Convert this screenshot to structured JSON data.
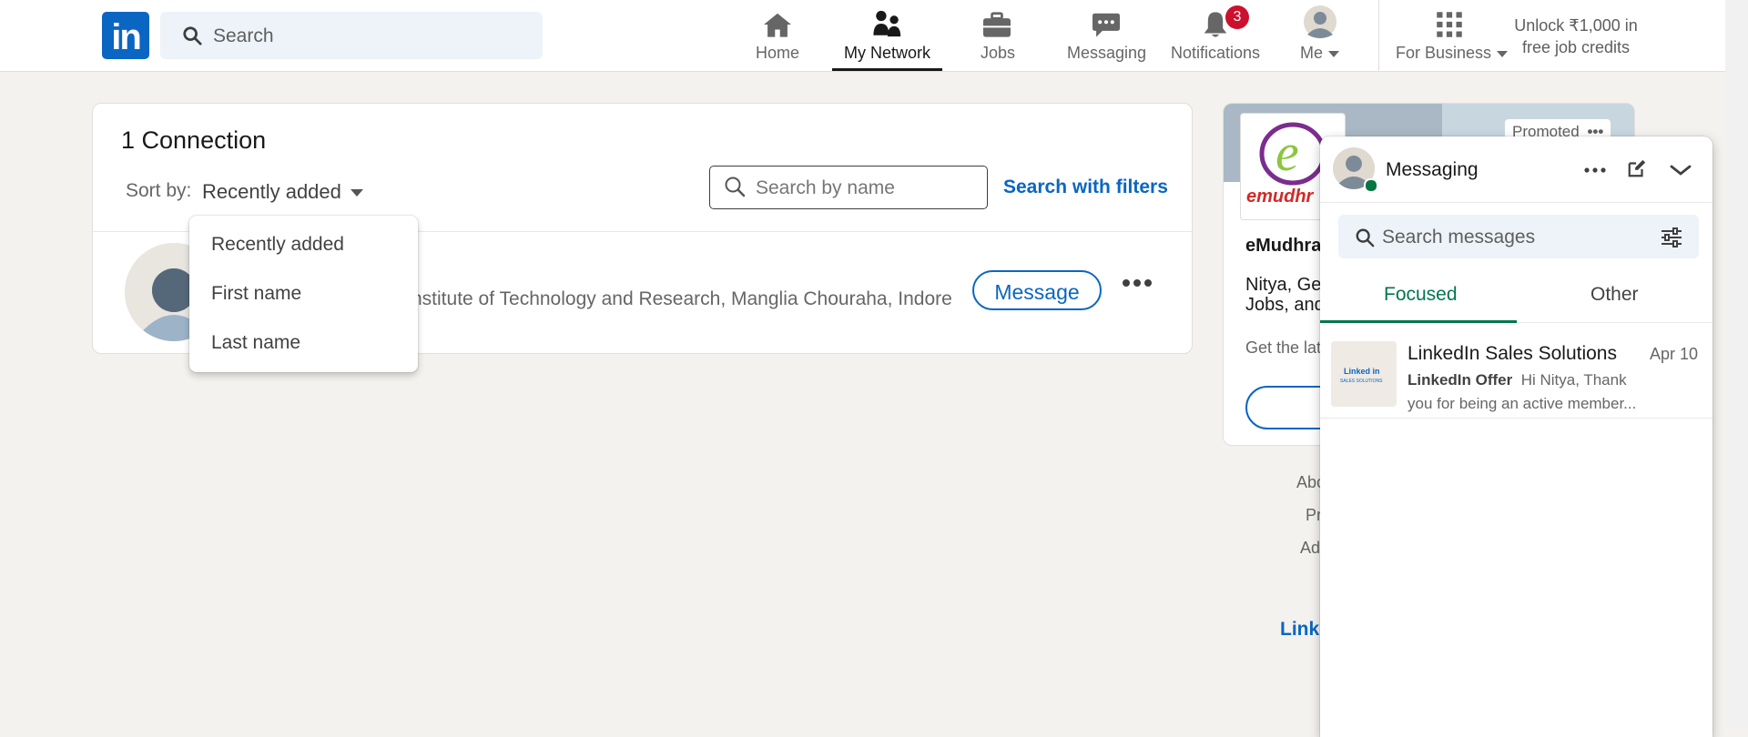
{
  "nav": {
    "logo_text": "in",
    "search_placeholder": "Search",
    "items": [
      {
        "label": "Home",
        "icon": "home-icon"
      },
      {
        "label": "My Network",
        "icon": "my-network-icon",
        "active": true
      },
      {
        "label": "Jobs",
        "icon": "jobs-briefcase-icon"
      },
      {
        "label": "Messaging",
        "icon": "messaging-bubble-icon"
      },
      {
        "label": "Notifications",
        "icon": "bell-icon",
        "badge": "3"
      },
      {
        "label": "Me",
        "icon": "profile-avatar-icon"
      }
    ],
    "for_business": "For Business",
    "unlock_line1": "Unlock ₹1,000 in",
    "unlock_line2": "free job credits"
  },
  "connections": {
    "count_title": "1 Connection",
    "sort_label": "Sort by:",
    "sort_value": "Recently added",
    "search_placeholder": "Search by name",
    "search_filters": "Search with filters",
    "row_subtitle": "nstitute of Technology and Research, Manglia Chouraha, Indore",
    "message_button": "Message"
  },
  "sort_dropdown": {
    "options": [
      "Recently added",
      "First name",
      "Last name"
    ]
  },
  "ad": {
    "promoted": "Promoted",
    "brand_logo_text": "emudhr",
    "name": "eMudhra",
    "text_line1": "Nitya, Ge",
    "text_line2": "Jobs, and",
    "sub": "Get the lat"
  },
  "footer": {
    "links": [
      "Abo",
      "Pr",
      "Ad"
    ],
    "brand": "Linke"
  },
  "messaging": {
    "title": "Messaging",
    "search_placeholder": "Search messages",
    "tabs": [
      "Focused",
      "Other"
    ],
    "conversations": [
      {
        "name": "LinkedIn Sales Solutions",
        "date": "Apr 10",
        "sender": "LinkedIn Offer",
        "preview": "Hi Nitya, Thank you for being an active member...",
        "logo_text": "Linked in",
        "logo_sub": "SALES SOLUTIONS"
      }
    ]
  },
  "colors": {
    "brand_blue": "#0a66c2",
    "focused_green": "#01754f",
    "notification_red": "#cb112d",
    "page_bg": "#f4f2ee"
  }
}
